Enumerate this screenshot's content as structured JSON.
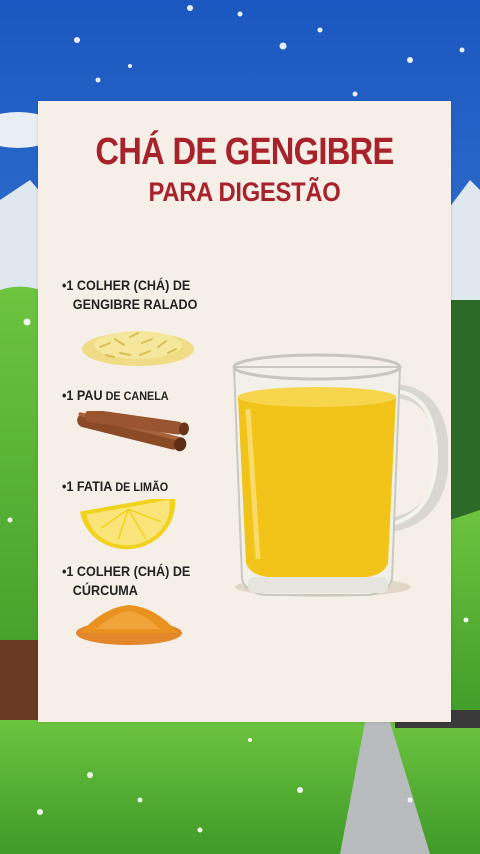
{
  "poster": {
    "title": "CHÁ DE GENGIBRE",
    "subtitle": "PARA DIGESTÃO",
    "ingredients": [
      {
        "bullet": "•",
        "line1": "1 COLHER (CHÁ) DE",
        "line2": "GENGIBRE RALADO",
        "icon": "grated-ginger"
      },
      {
        "bullet": "•",
        "num": "1 PAU",
        "rest": " DE CANELA",
        "icon": "cinnamon-stick"
      },
      {
        "bullet": "•",
        "num": "1 FATIA",
        "rest": " DE LIMÃO",
        "icon": "lemon-slice"
      },
      {
        "bullet": "•",
        "line1": "1 COLHER (CHÁ) DE",
        "line2": "CÚRCUMA",
        "icon": "turmeric-powder"
      }
    ],
    "drink_icon": "glass-mug-of-tea"
  },
  "colors": {
    "title_red": "#a8222b",
    "card_bg": "#f6efe8",
    "tea": "#f2c419",
    "sky": "#1d5fbf",
    "grass": "#4fb432"
  }
}
